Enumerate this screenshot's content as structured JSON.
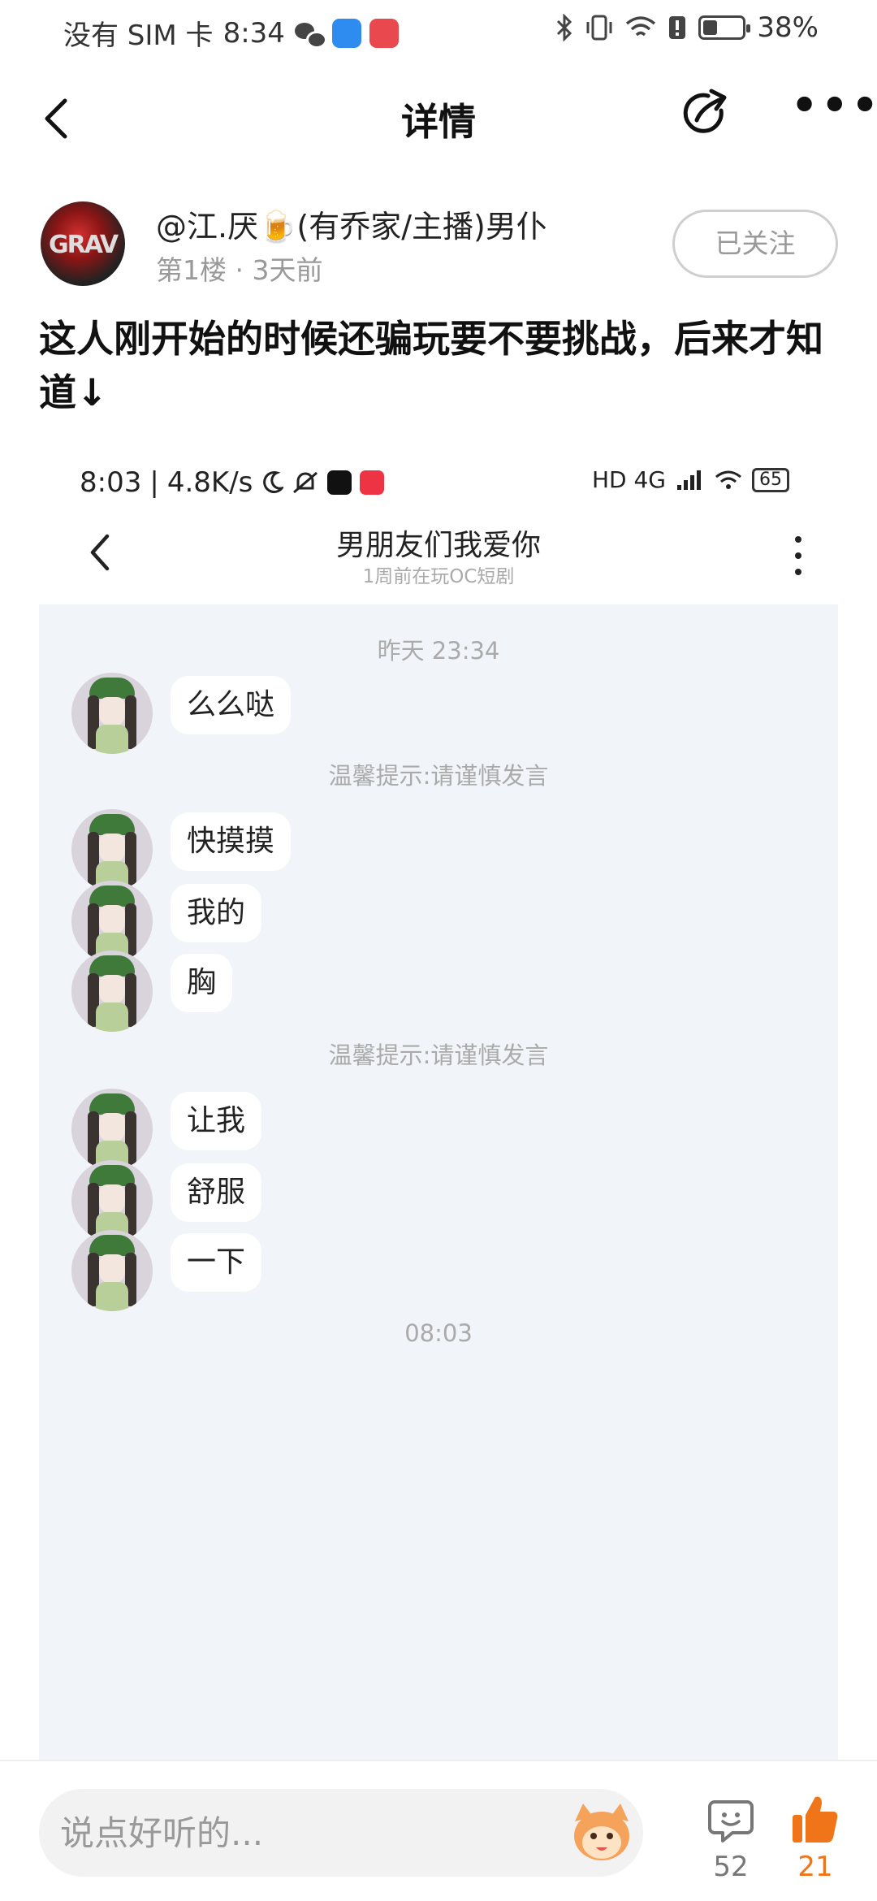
{
  "status_bar": {
    "carrier": "没有 SIM 卡",
    "time": "8:34",
    "battery_percent": "38%",
    "battery_level": 0.38
  },
  "nav": {
    "title": "详情",
    "back_icon": "chevron-left-icon",
    "share_icon": "share-icon",
    "more_icon": "more-icon",
    "more_glyph": "•••"
  },
  "post": {
    "username": "@江.厌🍺(有乔家/主播)男仆",
    "floor": "第1楼",
    "separator": "·",
    "time_ago": "3天前",
    "follow_label": "已关注",
    "text": "这人刚开始的时候还骗玩要不要挑战，后来才知道↓"
  },
  "screenshot": {
    "status_time": "8:03",
    "status_speed": "4.8K/s",
    "status_right": "HD 4G",
    "battery": "65",
    "title": "男朋友们我爱你",
    "subtitle": "1周前在玩OC短剧",
    "timestamp_1": "昨天 23:34",
    "warning": "温馨提示:请谨慎发言",
    "timestamp_2": "08:03",
    "messages": [
      "么么哒",
      "快摸摸",
      "我的",
      "胸",
      "让我",
      "舒服",
      "一下"
    ]
  },
  "bottom": {
    "placeholder": "说点好听的...",
    "comment_count": "52",
    "like_count": "21"
  },
  "colors": {
    "accent_like": "#f07418",
    "chat_bg": "#f1f4f8"
  }
}
